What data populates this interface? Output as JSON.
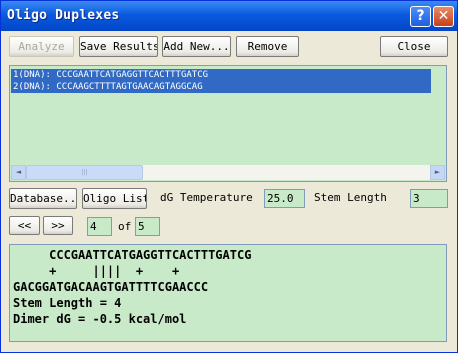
{
  "window": {
    "title": "Oligo Duplexes",
    "help_glyph": "?",
    "close_glyph": "✕"
  },
  "toolbar": {
    "analyze": "Analyze",
    "save_results": "Save Results",
    "add_new": "Add New...",
    "remove": "Remove",
    "close": "Close"
  },
  "sequences": [
    "1(DNA): CCCGAATTCATGAGGTTCACTTTGATCG",
    "2(DNA): CCCAAGCTTTTAGTGAACAGTAGGCAG"
  ],
  "scroll": {
    "left_glyph": "◄",
    "right_glyph": "►",
    "thumb_glyph": "|||"
  },
  "controls": {
    "database": "Database...",
    "oligo_list": "Oligo List",
    "dg_label": "dG Temperature",
    "dg_value": "25.0",
    "stem_label": "Stem Length",
    "stem_value": "3"
  },
  "nav": {
    "prev": "<<",
    "next": ">>",
    "current": "4",
    "of": "of",
    "total": "5"
  },
  "output": [
    "     CCCGAATTCATGAGGTTCACTTTGATCG",
    "     +     ||||  +    +",
    "GACGGATGACAAGTGATTTTCGAACCC",
    "Stem Length = 4",
    "Dimer dG = -0.5 kcal/mol"
  ]
}
